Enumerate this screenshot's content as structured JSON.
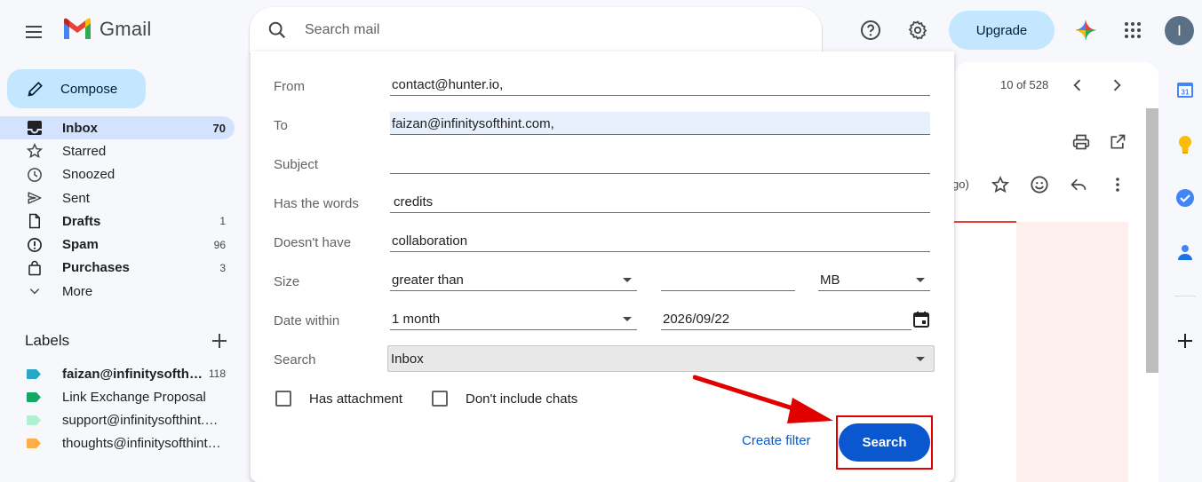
{
  "app": {
    "name": "Gmail"
  },
  "search": {
    "placeholder": "Search mail"
  },
  "header": {
    "upgrade_label": "Upgrade",
    "avatar_initial": "I"
  },
  "compose_label": "Compose",
  "nav": [
    {
      "label": "Inbox",
      "count": "70",
      "icon": "inbox-icon"
    },
    {
      "label": "Starred",
      "count": "",
      "icon": "star-icon"
    },
    {
      "label": "Snoozed",
      "count": "",
      "icon": "clock-icon"
    },
    {
      "label": "Sent",
      "count": "",
      "icon": "send-icon"
    },
    {
      "label": "Drafts",
      "count": "1",
      "icon": "draft-icon"
    },
    {
      "label": "Spam",
      "count": "96",
      "icon": "spam-icon"
    },
    {
      "label": "Purchases",
      "count": "3",
      "icon": "bag-icon"
    },
    {
      "label": "More",
      "count": "",
      "icon": "chevron-down-icon"
    }
  ],
  "labels": {
    "title": "Labels",
    "items": [
      {
        "label": "faizan@infinitysofthint.com",
        "count": "118",
        "color": "#2aa7c6"
      },
      {
        "label": "Link Exchange Proposal",
        "count": "",
        "color": "#16a765"
      },
      {
        "label": "support@infinitysofthint.com",
        "count": "",
        "color": "#b3efd3"
      },
      {
        "label": "thoughts@infinitysofthint.com",
        "count": "",
        "color": "#ffad46"
      }
    ]
  },
  "message_pane": {
    "pager": "10 of 528",
    "truncated_text": "go)"
  },
  "advanced_search": {
    "from_label": "From",
    "from_value": "contact@hunter.io,",
    "to_label": "To",
    "to_value": "faizan@infinitysofthint.com,",
    "subject_label": "Subject",
    "subject_value": "",
    "has_words_label": "Has the words",
    "has_words_value": "credits",
    "doesnt_have_label": "Doesn't have",
    "doesnt_have_value": "collaboration",
    "size_label": "Size",
    "size_operator": "greater than",
    "size_value": "",
    "size_unit": "MB",
    "date_label": "Date within",
    "date_range": "1 month",
    "date_value": "2026/09/22",
    "search_in_label": "Search",
    "search_in_value": "Inbox",
    "has_attachment_label": "Has attachment",
    "no_chats_label": "Don't include chats",
    "create_filter_label": "Create filter",
    "search_button_label": "Search"
  },
  "colors": {
    "accent": "#0b57d0",
    "compose_bg": "#c2e7ff",
    "active_nav": "#d3e3fd",
    "annotation": "#e00000"
  }
}
